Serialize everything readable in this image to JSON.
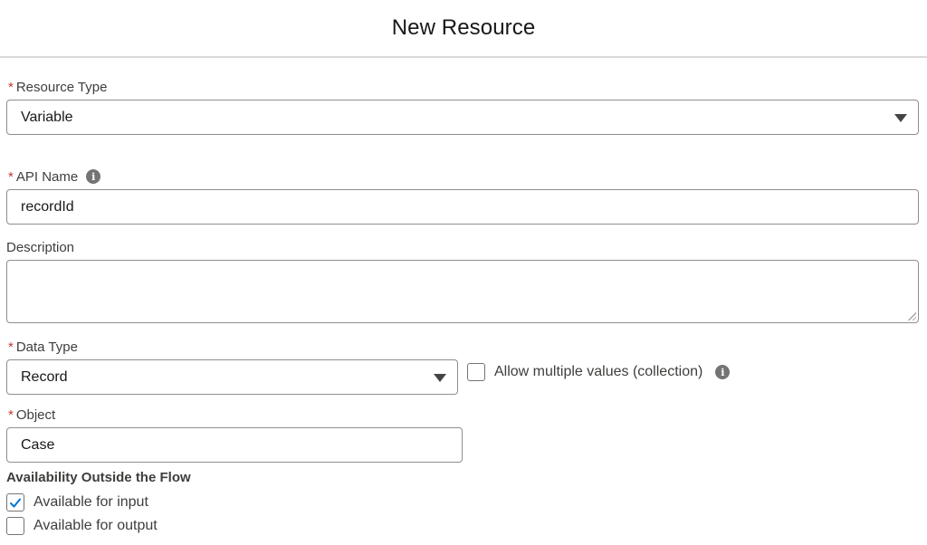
{
  "header": {
    "title": "New Resource"
  },
  "required_marker": "*",
  "resource_type": {
    "label": "Resource Type",
    "value": "Variable"
  },
  "api_name": {
    "label": "API Name",
    "value": "recordId"
  },
  "description": {
    "label": "Description",
    "value": ""
  },
  "data_type": {
    "label": "Data Type",
    "value": "Record",
    "collection": {
      "label": "Allow multiple values (collection)",
      "checked": false
    }
  },
  "object": {
    "label": "Object",
    "value": "Case"
  },
  "availability": {
    "title": "Availability Outside the Flow",
    "options": [
      {
        "label": "Available for input",
        "checked": true
      },
      {
        "label": "Available for output",
        "checked": false
      }
    ]
  },
  "icons": {
    "info": "info-icon",
    "dropdown": "chevron-down-icon",
    "check": "check-icon"
  },
  "colors": {
    "required": "#c23934",
    "check": "#0176d3",
    "border": "#8e8e8e"
  }
}
